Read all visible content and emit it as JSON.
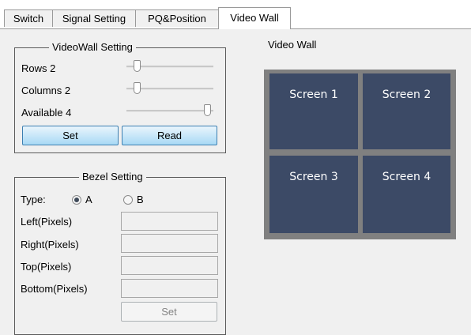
{
  "tabs": [
    {
      "label": "Switch"
    },
    {
      "label": "Signal Setting"
    },
    {
      "label": "PQ&Position"
    },
    {
      "label": "Video Wall"
    }
  ],
  "videowall_setting": {
    "title": "VideoWall Setting",
    "rows": {
      "label": "Rows 2",
      "value": 2
    },
    "columns": {
      "label": "Columns 2",
      "value": 2
    },
    "available": {
      "label": "Available 4",
      "value": 4
    },
    "set_label": "Set",
    "read_label": "Read"
  },
  "bezel_setting": {
    "title": "Bezel Setting",
    "type_label": "Type:",
    "option_a": "A",
    "option_b": "B",
    "selected": "A",
    "fields": [
      {
        "label": "Left(Pixels)",
        "value": ""
      },
      {
        "label": "Right(Pixels)",
        "value": ""
      },
      {
        "label": "Top(Pixels)",
        "value": ""
      },
      {
        "label": "Bottom(Pixels)",
        "value": ""
      }
    ],
    "set_label": "Set"
  },
  "video_wall": {
    "title": "Video Wall",
    "screens": [
      {
        "label": "Screen 1"
      },
      {
        "label": "Screen 2"
      },
      {
        "label": "Screen 3"
      },
      {
        "label": "Screen 4"
      }
    ],
    "colors": {
      "screen": "#3c4a66",
      "frame": "#808080"
    }
  }
}
